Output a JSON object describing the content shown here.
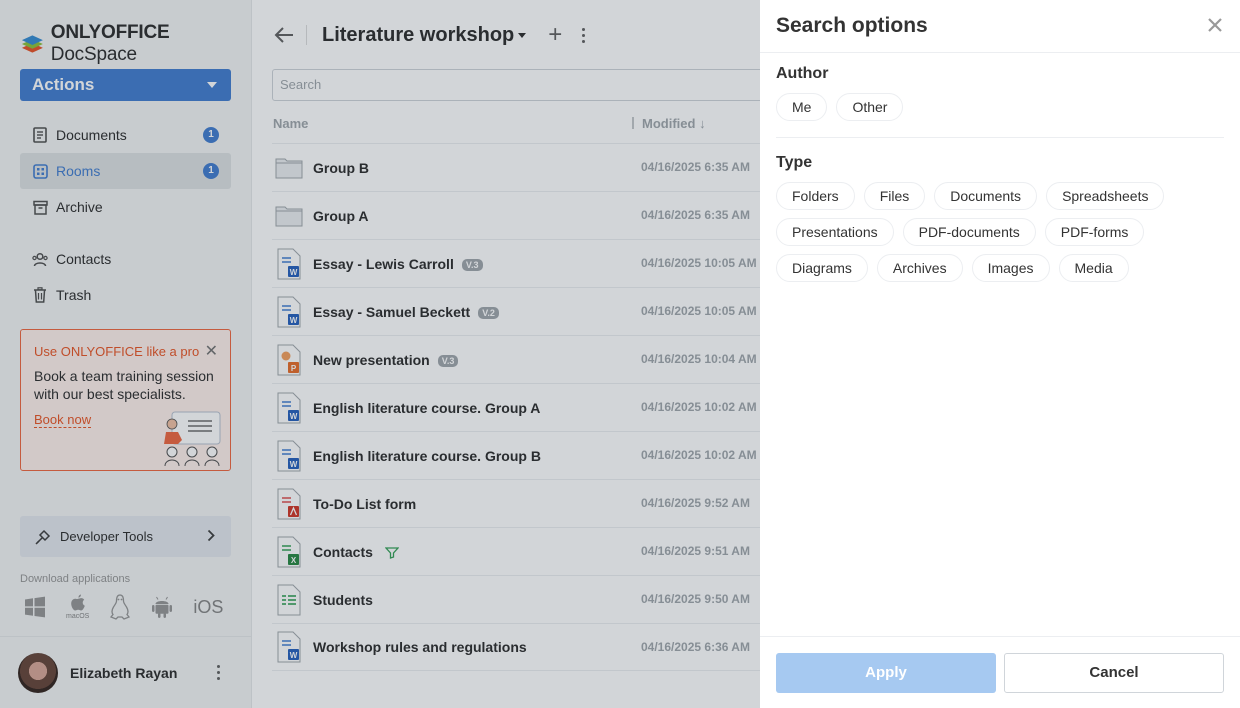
{
  "app": {
    "logo_bold": "ONLYOFFICE",
    "logo_light": " DocSpace",
    "actions_label": "Actions"
  },
  "sidebar": {
    "items": [
      {
        "label": "Documents",
        "icon": "documents-icon",
        "badge": "1"
      },
      {
        "label": "Rooms",
        "icon": "rooms-icon",
        "badge": "1",
        "active": true
      },
      {
        "label": "Archive",
        "icon": "archive-icon"
      },
      {
        "label": "Contacts",
        "icon": "contacts-icon"
      },
      {
        "label": "Trash",
        "icon": "trash-icon"
      }
    ],
    "promo": {
      "title": "Use ONLYOFFICE like a pro",
      "body": "Book a team training session with our best specialists.",
      "link": "Book now"
    },
    "developer_tools": "Developer Tools",
    "download_title": "Download applications",
    "download_apps": [
      "Windows",
      "macOS",
      "Linux",
      "Android",
      "iOS"
    ],
    "macos_label": "macOS",
    "ios_label": "iOS",
    "user_name": "Elizabeth Rayan"
  },
  "main": {
    "room_title": "Literature workshop",
    "search_placeholder": "Search",
    "col_name": "Name",
    "col_modified": "Modified",
    "files": [
      {
        "name": "Group B",
        "type": "folder",
        "modified": "04/16/2025 6:35 AM"
      },
      {
        "name": "Group A",
        "type": "folder",
        "modified": "04/16/2025 6:35 AM"
      },
      {
        "name": "Essay - Lewis Carroll",
        "type": "docx",
        "version": "V.3",
        "modified": "04/16/2025 10:05 AM"
      },
      {
        "name": "Essay - Samuel Beckett",
        "type": "docx",
        "version": "V.2",
        "modified": "04/16/2025 10:05 AM"
      },
      {
        "name": "New presentation",
        "type": "pptx",
        "version": "V.3",
        "modified": "04/16/2025 10:04 AM"
      },
      {
        "name": "English literature course. Group A",
        "type": "docx",
        "modified": "04/16/2025 10:02 AM"
      },
      {
        "name": "English literature course. Group B",
        "type": "docx",
        "modified": "04/16/2025 10:02 AM"
      },
      {
        "name": "To-Do List form",
        "type": "pdf",
        "modified": "04/16/2025 9:52 AM"
      },
      {
        "name": "Contacts",
        "type": "xlsx",
        "modified": "04/16/2025 9:51 AM",
        "filter_tag": true
      },
      {
        "name": "Students",
        "type": "csv",
        "modified": "04/16/2025 9:50 AM"
      },
      {
        "name": "Workshop rules and regulations",
        "type": "docx",
        "modified": "04/16/2025 6:36 AM"
      }
    ]
  },
  "panel": {
    "title": "Search options",
    "author_title": "Author",
    "author_options": [
      "Me",
      "Other"
    ],
    "type_title": "Type",
    "type_options": [
      "Folders",
      "Files",
      "Documents",
      "Spreadsheets",
      "Presentations",
      "PDF-documents",
      "PDF-forms",
      "Diagrams",
      "Archives",
      "Images",
      "Media"
    ],
    "apply_label": "Apply",
    "cancel_label": "Cancel"
  },
  "colors": {
    "accent": "#4781d1",
    "promo_orange": "#ea5a2b",
    "apply_disabled": "#a6c9f1"
  }
}
